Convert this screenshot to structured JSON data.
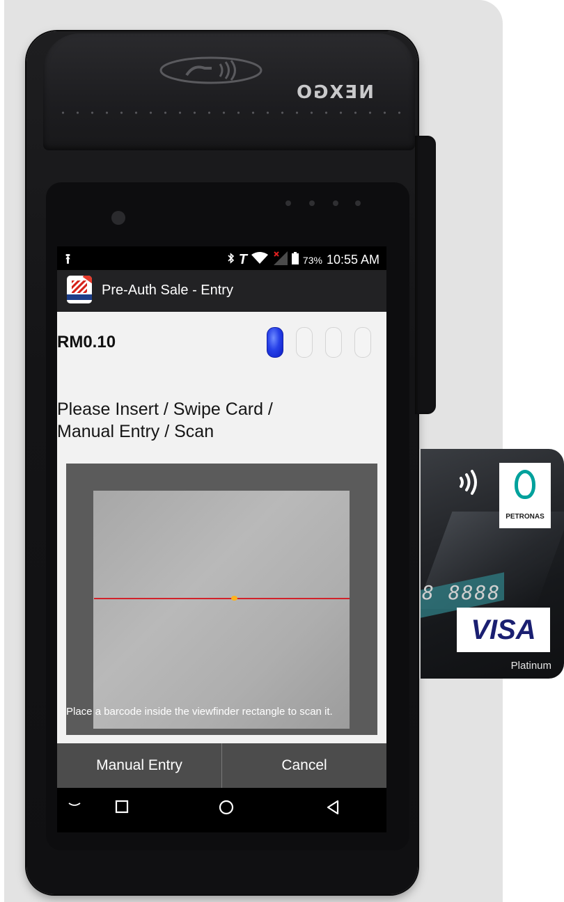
{
  "device": {
    "brand": "NEXGO"
  },
  "status_bar": {
    "battery": "73%",
    "time": "10:55 AM",
    "icons": [
      "upload-icon",
      "bluetooth-icon",
      "t-icon",
      "wifi-icon",
      "signal-off-icon",
      "battery-icon"
    ]
  },
  "app_bar": {
    "logo_label": "Merchant",
    "title": "Pre-Auth Sale - Entry"
  },
  "transaction": {
    "amount": "RM0.10",
    "steps_total": 4,
    "current_step": 1
  },
  "prompt": {
    "line1": "Please Insert / Swipe Card /",
    "line2": "Manual Entry / Scan"
  },
  "scanner": {
    "hint": "Place a barcode inside the viewfinder rectangle to scan it."
  },
  "actions": {
    "manual_entry": "Manual Entry",
    "cancel": "Cancel"
  },
  "nav": {
    "icons": [
      "hide-keyboard-icon",
      "recents-icon",
      "home-icon",
      "back-icon"
    ]
  },
  "card": {
    "issuer": "PETRONAS",
    "number_fragment": "8 8888",
    "network": "VISA",
    "tier": "Platinum"
  },
  "colors": {
    "panel": "#e3e3e3",
    "screen_bg": "#f2f2f2",
    "active_step": "#2741e8",
    "laser": "#d1222a",
    "action_bar": "#4c4c4c"
  }
}
